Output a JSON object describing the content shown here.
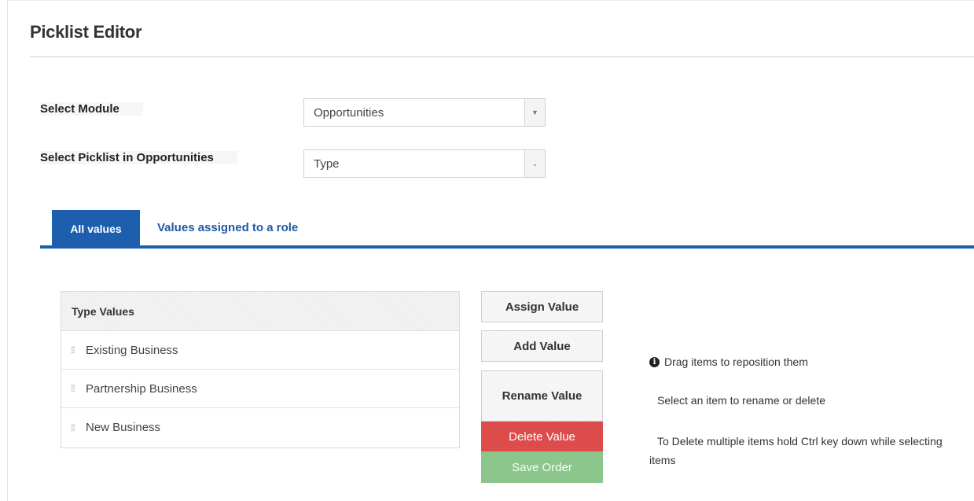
{
  "page": {
    "title": "Picklist Editor"
  },
  "form": {
    "module_label": "Select Module",
    "module_value": "Opportunities",
    "picklist_label": "Select Picklist in Opportunities",
    "picklist_value": "Type"
  },
  "tabs": [
    {
      "label": "All values",
      "active": true
    },
    {
      "label": "Values assigned to a role",
      "active": false
    }
  ],
  "values_table": {
    "header": "Type Values",
    "rows": [
      "Existing Business",
      "Partnership Business",
      "New Business"
    ]
  },
  "buttons": {
    "assign": "Assign Value",
    "add": "Add Value",
    "rename": "Rename Value",
    "delete": "Delete Value",
    "save": "Save Order"
  },
  "hints": {
    "drag": "Drag items to reposition them",
    "select": "Select an item to rename or delete",
    "multi": "To Delete multiple items hold Ctrl key down while selecting items"
  },
  "colors": {
    "accent": "#1d5fae",
    "delete": "#de4b4b",
    "save": "#8dc68d"
  },
  "icons": {
    "info": "info-circle-icon",
    "drag": "drag-handle-icon",
    "dropdown": "chevron-down-icon"
  }
}
